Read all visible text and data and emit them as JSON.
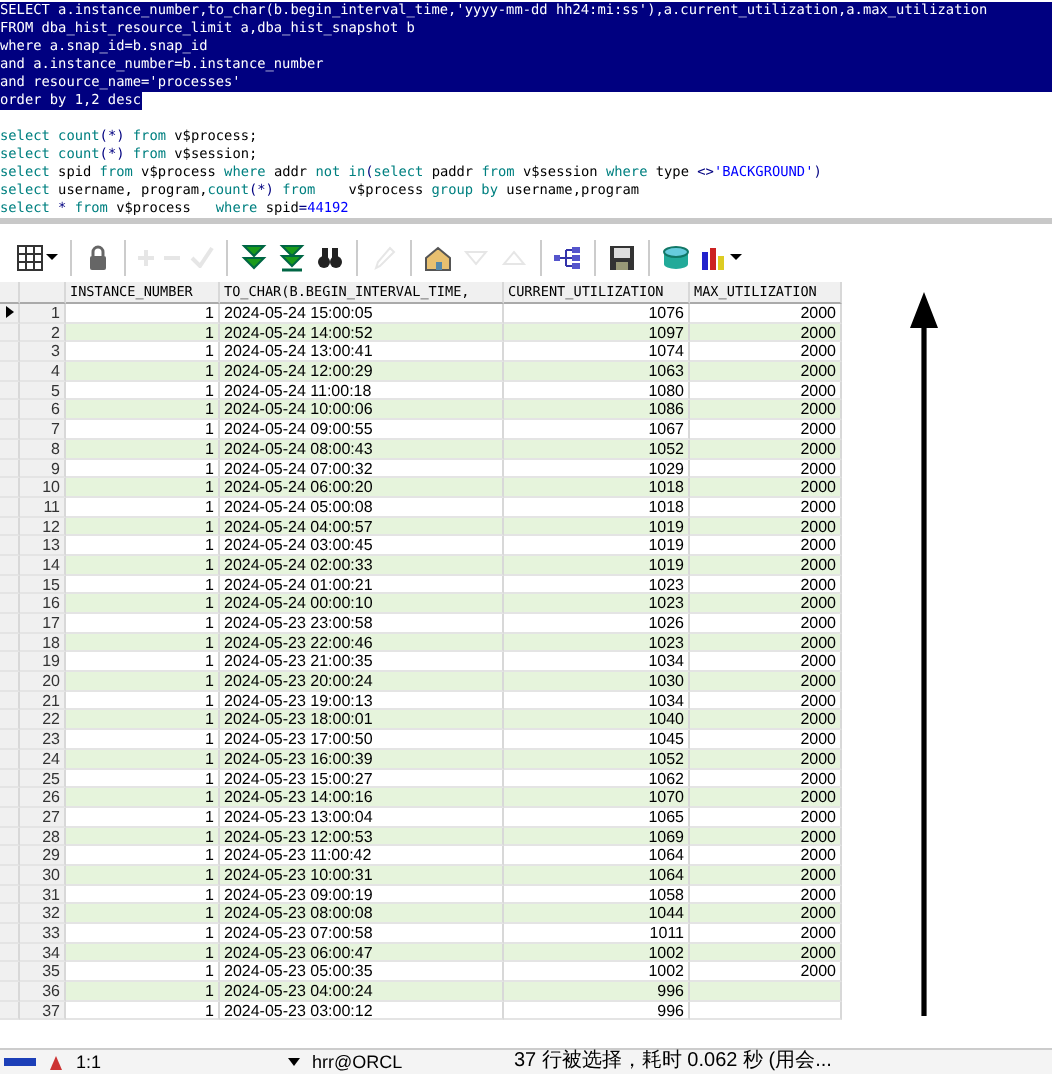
{
  "editor": {
    "lines": [
      {
        "selected": true,
        "tokens": [
          {
            "kind": "plain",
            "text": "SELECT a.instance_number,to_char(b.begin_interval_time,'yyyy-mm-dd hh24:mi:ss'),a.current_utilization,a.max_utilization"
          }
        ]
      },
      {
        "selected": true,
        "tokens": [
          {
            "kind": "plain",
            "text": "FROM dba_hist_resource_limit a,dba_hist_snapshot b"
          }
        ]
      },
      {
        "selected": true,
        "tokens": [
          {
            "kind": "plain",
            "text": "where a.snap_id=b.snap_id"
          }
        ]
      },
      {
        "selected": true,
        "tokens": [
          {
            "kind": "plain",
            "text": "and a.instance_number=b.instance_number"
          }
        ]
      },
      {
        "selected": true,
        "tokens": [
          {
            "kind": "plain",
            "text": "and resource_name='processes'"
          }
        ]
      },
      {
        "selected": true,
        "tokens": [
          {
            "kind": "plain",
            "text": "order by 1,2 desc"
          }
        ]
      },
      {
        "selected": false,
        "tokens": [
          {
            "kind": "kw",
            "text": "select "
          },
          {
            "kind": "kw",
            "text": "count"
          },
          {
            "kind": "op",
            "text": "(*)"
          },
          {
            "kind": "kw",
            "text": " from "
          },
          {
            "kind": "plain",
            "text": "v$process;"
          }
        ]
      },
      {
        "selected": false,
        "tokens": [
          {
            "kind": "kw",
            "text": "select "
          },
          {
            "kind": "kw",
            "text": "count"
          },
          {
            "kind": "op",
            "text": "(*)"
          },
          {
            "kind": "kw",
            "text": " from "
          },
          {
            "kind": "plain",
            "text": "v$session;"
          }
        ]
      },
      {
        "selected": false,
        "tokens": [
          {
            "kind": "kw",
            "text": "select "
          },
          {
            "kind": "plain",
            "text": "spid "
          },
          {
            "kind": "kw",
            "text": "from "
          },
          {
            "kind": "plain",
            "text": "v$process "
          },
          {
            "kind": "kw",
            "text": "where "
          },
          {
            "kind": "plain",
            "text": "addr "
          },
          {
            "kind": "kw",
            "text": "not in"
          },
          {
            "kind": "op",
            "text": "("
          },
          {
            "kind": "kw",
            "text": "select "
          },
          {
            "kind": "plain",
            "text": "paddr "
          },
          {
            "kind": "kw",
            "text": "from "
          },
          {
            "kind": "plain",
            "text": "v$session "
          },
          {
            "kind": "kw",
            "text": "where "
          },
          {
            "kind": "plain",
            "text": "type "
          },
          {
            "kind": "op",
            "text": "<>"
          },
          {
            "kind": "str",
            "text": "'BACKGROUND'"
          },
          {
            "kind": "op",
            "text": ")"
          }
        ]
      },
      {
        "selected": false,
        "tokens": [
          {
            "kind": "kw",
            "text": "select "
          },
          {
            "kind": "plain",
            "text": "username, program,"
          },
          {
            "kind": "kw",
            "text": "count"
          },
          {
            "kind": "op",
            "text": "(*)"
          },
          {
            "kind": "kw",
            "text": " from    "
          },
          {
            "kind": "plain",
            "text": "v$process "
          },
          {
            "kind": "kw",
            "text": "group by "
          },
          {
            "kind": "plain",
            "text": "username,program"
          }
        ]
      },
      {
        "selected": false,
        "tokens": [
          {
            "kind": "kw",
            "text": "select "
          },
          {
            "kind": "op",
            "text": "* "
          },
          {
            "kind": "kw",
            "text": "from "
          },
          {
            "kind": "plain",
            "text": "v$process   "
          },
          {
            "kind": "kw",
            "text": "where "
          },
          {
            "kind": "plain",
            "text": "spid"
          },
          {
            "kind": "op",
            "text": "="
          },
          {
            "kind": "str",
            "text": "44192"
          }
        ]
      }
    ]
  },
  "toolbar": [
    {
      "kind": "grid",
      "disabled": false,
      "dropdown": true
    },
    {
      "kind": "lock",
      "disabled": false,
      "dropdown": false
    },
    {
      "kind": "plus",
      "disabled": true,
      "dropdown": false
    },
    {
      "kind": "minus",
      "disabled": true,
      "dropdown": false
    },
    {
      "kind": "check",
      "disabled": true,
      "dropdown": false
    },
    {
      "kind": "fetch",
      "disabled": false,
      "dropdown": false
    },
    {
      "kind": "fetch-all",
      "disabled": false,
      "dropdown": false
    },
    {
      "kind": "binoculars",
      "disabled": false,
      "dropdown": false
    },
    {
      "kind": "pencil",
      "disabled": true,
      "dropdown": false
    },
    {
      "kind": "house",
      "disabled": false,
      "dropdown": false
    },
    {
      "kind": "down",
      "disabled": true,
      "dropdown": false
    },
    {
      "kind": "up",
      "disabled": true,
      "dropdown": false
    },
    {
      "kind": "tree",
      "disabled": false,
      "dropdown": false
    },
    {
      "kind": "save",
      "disabled": false,
      "dropdown": false
    },
    {
      "kind": "database",
      "disabled": false,
      "dropdown": false
    },
    {
      "kind": "chart",
      "disabled": false,
      "dropdown": true
    }
  ],
  "table": {
    "columns": [
      "INSTANCE_NUMBER",
      "TO_CHAR(B.BEGIN_INTERVAL_TIME,",
      "CURRENT_UTILIZATION",
      "MAX_UTILIZATION"
    ],
    "rows": [
      {
        "n": "1",
        "selected": true,
        "cells": [
          "1",
          "2024-05-24 15:00:05",
          "1076",
          "2000"
        ]
      },
      {
        "n": "2",
        "selected": false,
        "cells": [
          "1",
          "2024-05-24 14:00:52",
          "1097",
          "2000"
        ]
      },
      {
        "n": "3",
        "selected": false,
        "cells": [
          "1",
          "2024-05-24 13:00:41",
          "1074",
          "2000"
        ]
      },
      {
        "n": "4",
        "selected": false,
        "cells": [
          "1",
          "2024-05-24 12:00:29",
          "1063",
          "2000"
        ]
      },
      {
        "n": "5",
        "selected": false,
        "cells": [
          "1",
          "2024-05-24 11:00:18",
          "1080",
          "2000"
        ]
      },
      {
        "n": "6",
        "selected": false,
        "cells": [
          "1",
          "2024-05-24 10:00:06",
          "1086",
          "2000"
        ]
      },
      {
        "n": "7",
        "selected": false,
        "cells": [
          "1",
          "2024-05-24 09:00:55",
          "1067",
          "2000"
        ]
      },
      {
        "n": "8",
        "selected": false,
        "cells": [
          "1",
          "2024-05-24 08:00:43",
          "1052",
          "2000"
        ]
      },
      {
        "n": "9",
        "selected": false,
        "cells": [
          "1",
          "2024-05-24 07:00:32",
          "1029",
          "2000"
        ]
      },
      {
        "n": "10",
        "selected": false,
        "cells": [
          "1",
          "2024-05-24 06:00:20",
          "1018",
          "2000"
        ]
      },
      {
        "n": "11",
        "selected": false,
        "cells": [
          "1",
          "2024-05-24 05:00:08",
          "1018",
          "2000"
        ]
      },
      {
        "n": "12",
        "selected": false,
        "cells": [
          "1",
          "2024-05-24 04:00:57",
          "1019",
          "2000"
        ]
      },
      {
        "n": "13",
        "selected": false,
        "cells": [
          "1",
          "2024-05-24 03:00:45",
          "1019",
          "2000"
        ]
      },
      {
        "n": "14",
        "selected": false,
        "cells": [
          "1",
          "2024-05-24 02:00:33",
          "1019",
          "2000"
        ]
      },
      {
        "n": "15",
        "selected": false,
        "cells": [
          "1",
          "2024-05-24 01:00:21",
          "1023",
          "2000"
        ]
      },
      {
        "n": "16",
        "selected": false,
        "cells": [
          "1",
          "2024-05-24 00:00:10",
          "1023",
          "2000"
        ]
      },
      {
        "n": "17",
        "selected": false,
        "cells": [
          "1",
          "2024-05-23 23:00:58",
          "1026",
          "2000"
        ]
      },
      {
        "n": "18",
        "selected": false,
        "cells": [
          "1",
          "2024-05-23 22:00:46",
          "1023",
          "2000"
        ]
      },
      {
        "n": "19",
        "selected": false,
        "cells": [
          "1",
          "2024-05-23 21:00:35",
          "1034",
          "2000"
        ]
      },
      {
        "n": "20",
        "selected": false,
        "cells": [
          "1",
          "2024-05-23 20:00:24",
          "1030",
          "2000"
        ]
      },
      {
        "n": "21",
        "selected": false,
        "cells": [
          "1",
          "2024-05-23 19:00:13",
          "1034",
          "2000"
        ]
      },
      {
        "n": "22",
        "selected": false,
        "cells": [
          "1",
          "2024-05-23 18:00:01",
          "1040",
          "2000"
        ]
      },
      {
        "n": "23",
        "selected": false,
        "cells": [
          "1",
          "2024-05-23 17:00:50",
          "1045",
          "2000"
        ]
      },
      {
        "n": "24",
        "selected": false,
        "cells": [
          "1",
          "2024-05-23 16:00:39",
          "1052",
          "2000"
        ]
      },
      {
        "n": "25",
        "selected": false,
        "cells": [
          "1",
          "2024-05-23 15:00:27",
          "1062",
          "2000"
        ]
      },
      {
        "n": "26",
        "selected": false,
        "cells": [
          "1",
          "2024-05-23 14:00:16",
          "1070",
          "2000"
        ]
      },
      {
        "n": "27",
        "selected": false,
        "cells": [
          "1",
          "2024-05-23 13:00:04",
          "1065",
          "2000"
        ]
      },
      {
        "n": "28",
        "selected": false,
        "cells": [
          "1",
          "2024-05-23 12:00:53",
          "1069",
          "2000"
        ]
      },
      {
        "n": "29",
        "selected": false,
        "cells": [
          "1",
          "2024-05-23 11:00:42",
          "1064",
          "2000"
        ]
      },
      {
        "n": "30",
        "selected": false,
        "cells": [
          "1",
          "2024-05-23 10:00:31",
          "1064",
          "2000"
        ]
      },
      {
        "n": "31",
        "selected": false,
        "cells": [
          "1",
          "2024-05-23 09:00:19",
          "1058",
          "2000"
        ]
      },
      {
        "n": "32",
        "selected": false,
        "cells": [
          "1",
          "2024-05-23 08:00:08",
          "1044",
          "2000"
        ]
      },
      {
        "n": "33",
        "selected": false,
        "cells": [
          "1",
          "2024-05-23 07:00:58",
          "1011",
          "2000"
        ]
      },
      {
        "n": "34",
        "selected": false,
        "cells": [
          "1",
          "2024-05-23 06:00:47",
          "1002",
          "2000"
        ]
      },
      {
        "n": "35",
        "selected": false,
        "cells": [
          "1",
          "2024-05-23 05:00:35",
          "1002",
          "2000"
        ]
      },
      {
        "n": "36",
        "selected": false,
        "cells": [
          "1",
          "2024-05-23 04:00:24",
          "996"
        ]
      },
      {
        "n": "37",
        "selected": false,
        "cells": [
          "1",
          "2024-05-23 03:00:12",
          "996"
        ]
      }
    ]
  },
  "status_bar": {
    "position": "1:1",
    "connection": "hrr@ORCL",
    "message": "37 行被选择，耗时 0.062 秒 (用会..."
  }
}
